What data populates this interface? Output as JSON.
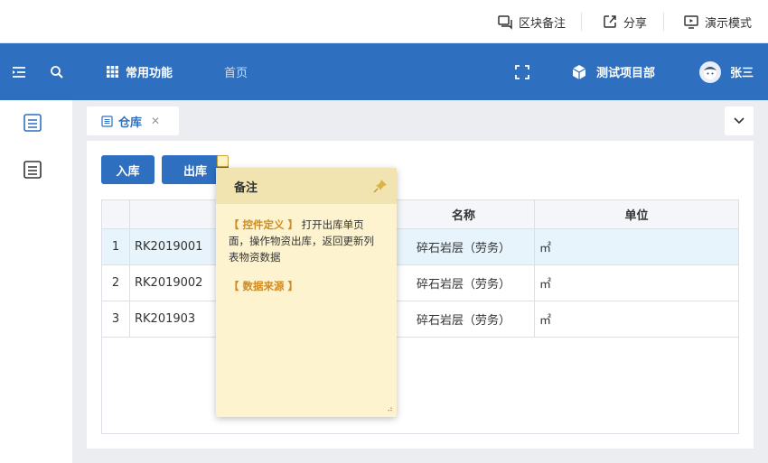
{
  "toolbar": {
    "block_note": "区块备注",
    "share": "分享",
    "present": "演示模式"
  },
  "header": {
    "common_functions": "常用功能",
    "home": "首页",
    "project": "测试项目部",
    "user": "张三"
  },
  "tab": {
    "label": "仓库",
    "close": "✕"
  },
  "buttons": {
    "inbound": "入库",
    "outbound": "出库"
  },
  "table": {
    "columns": [
      "",
      "",
      "名称",
      "单位"
    ],
    "rows": [
      {
        "idx": "1",
        "code": "RK2019001",
        "name": "碎石岩层（劳务）",
        "unit": "㎡"
      },
      {
        "idx": "2",
        "code": "RK2019002",
        "name": "碎石岩层（劳务）",
        "unit": "㎡"
      },
      {
        "idx": "3",
        "code": "RK201903",
        "name": "碎石岩层（劳务）",
        "unit": "㎡"
      }
    ]
  },
  "note": {
    "title": "备注",
    "tag1": "【 控件定义 】",
    "text1": "打开出库单页面，操作物资出库，返回更新列表物资数据",
    "tag2": "【 数据来源 】"
  },
  "colors": {
    "brand": "#2f6fc0",
    "note_bg": "#fdf4cf",
    "note_tag": "#d38a1e",
    "selected_row": "#e8f4fb"
  }
}
